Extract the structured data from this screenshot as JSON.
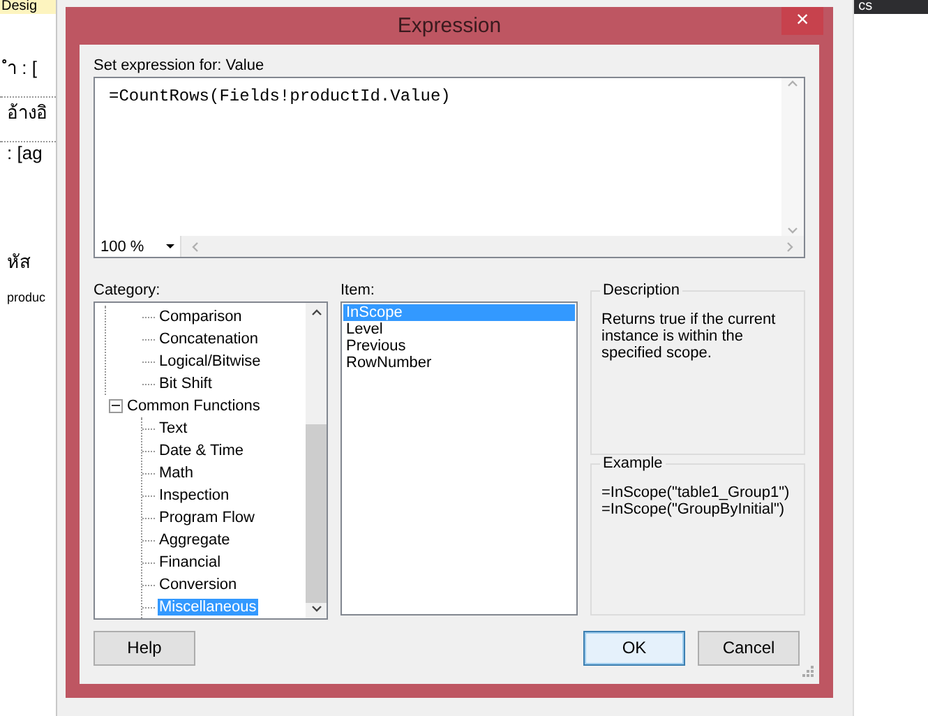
{
  "background": {
    "left_tab": "Desig",
    "right_tab": "cs",
    "designer_texts": [
      "ำ : [",
      "อ้างอิ",
      ": [ag",
      "หัส",
      "produc"
    ]
  },
  "dialog": {
    "title": "Expression",
    "close": "×",
    "prompt": "Set expression for: Value",
    "expression": "=CountRows(Fields!productId.Value)",
    "zoom": "100 %",
    "category_label": "Category:",
    "categories": [
      {
        "children": [
          {
            "label": "Comparison",
            "selected": false
          },
          {
            "label": "Concatenation",
            "selected": false
          },
          {
            "label": "Logical/Bitwise",
            "selected": false
          },
          {
            "label": "Bit Shift",
            "selected": false
          }
        ]
      },
      {
        "label": "Common Functions",
        "selected": false,
        "expanded": true,
        "children": [
          {
            "label": "Text",
            "selected": false
          },
          {
            "label": "Date & Time",
            "selected": false
          },
          {
            "label": "Math",
            "selected": false
          },
          {
            "label": "Inspection",
            "selected": false
          },
          {
            "label": "Program Flow",
            "selected": false
          },
          {
            "label": "Aggregate",
            "selected": false
          },
          {
            "label": "Financial",
            "selected": false
          },
          {
            "label": "Conversion",
            "selected": false
          },
          {
            "label": "Miscellaneous",
            "selected": true
          }
        ]
      }
    ],
    "item_label": "Item:",
    "items": [
      {
        "label": "InScope",
        "selected": true
      },
      {
        "label": "Level",
        "selected": false
      },
      {
        "label": "Previous",
        "selected": false
      },
      {
        "label": "RowNumber",
        "selected": false
      }
    ],
    "description": {
      "title": "Description",
      "text": "Returns true if the current instance is within the specified scope."
    },
    "example": {
      "title": "Example",
      "lines": [
        "=InScope(\"table1_Group1\")",
        "=InScope(\"GroupByInitial\")"
      ]
    },
    "buttons": [
      {
        "label": "Help",
        "default": false
      },
      {
        "label": "OK",
        "default": true
      },
      {
        "label": "Cancel",
        "default": false
      }
    ]
  }
}
